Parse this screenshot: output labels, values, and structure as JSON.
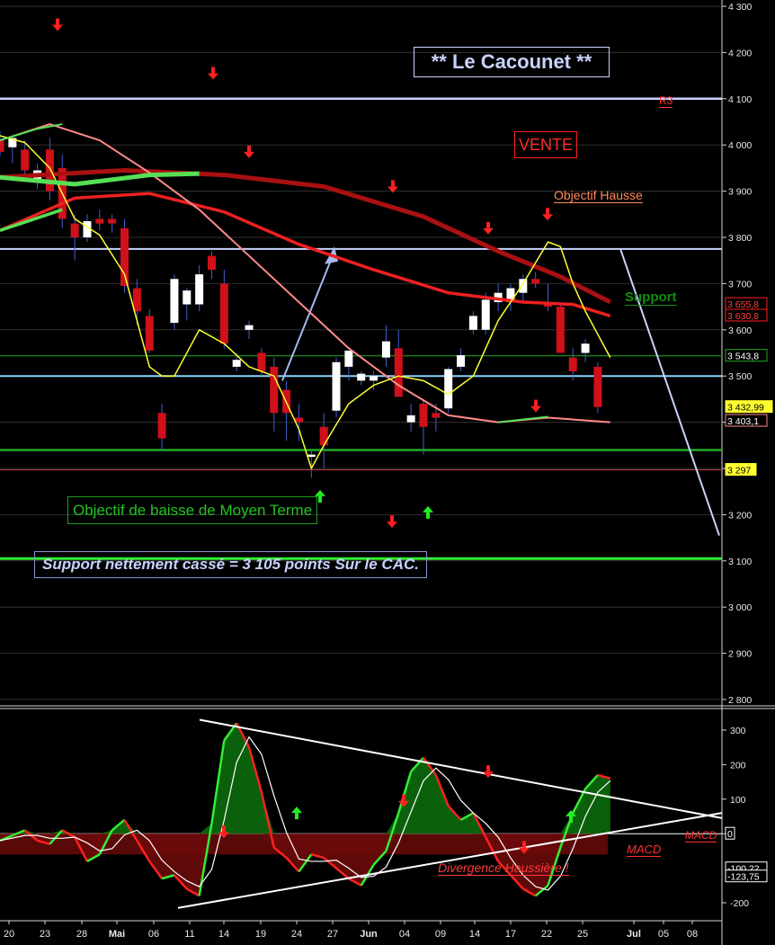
{
  "annotations": {
    "title": "** Le Cacounet **",
    "vente": "VENTE",
    "objectif_hausse": "Objectif Hausse",
    "support": "Support",
    "r3": "R3",
    "objectif_baisse": "Objectif de baisse de Moyen Terme",
    "support_casse": "Support nettement cassé = 3 105 points Sur le CAC.",
    "macd_label": "MACD",
    "macd_label_right": "MACD",
    "divergence": "Divergence Haussière !"
  },
  "colors": {
    "background": "#000000",
    "up_candle": "#ffffff",
    "down_candle": "#d0101a",
    "resistance_line": "#c8d2ff",
    "support_line": "#22dd22",
    "mm_long": "#aa1010",
    "mm_medium": "#ee2020",
    "mm_short": "#ff8a8a",
    "stoch_line": "#ffff30",
    "macd_positive": "#0c6a0c",
    "macd_negative": "#6a0a0a"
  },
  "chart_data": [
    {
      "type": "candlestick",
      "panel": "price",
      "x_tick_labels": [
        "20",
        "23",
        "28",
        "Mai",
        "06",
        "11",
        "14",
        "19",
        "24",
        "27",
        "Jun",
        "04",
        "09",
        "14",
        "17",
        "22",
        "25",
        "Jul",
        "05",
        "08"
      ],
      "y_ticks": [
        "4 300",
        "4 200",
        "4 100",
        "4 000",
        "3 900",
        "3 800",
        "3 700",
        "3 600",
        "3 500",
        "3 400",
        "3 300",
        "3 200",
        "3 100",
        "3 000",
        "2 900",
        "2 800"
      ],
      "y_tick_values": [
        4300,
        4200,
        4100,
        4000,
        3900,
        3800,
        3700,
        3600,
        3500,
        3400,
        3300,
        3200,
        3100,
        3000,
        2900,
        2800
      ],
      "ylim": [
        2780,
        4330
      ],
      "candles": [
        [
          4010,
          4030,
          3975,
          3985
        ],
        [
          3995,
          4020,
          3960,
          4015
        ],
        [
          3990,
          4010,
          3930,
          3945
        ],
        [
          3920,
          3960,
          3905,
          3945
        ],
        [
          3990,
          4015,
          3880,
          3900
        ],
        [
          3950,
          3980,
          3820,
          3840
        ],
        [
          3830,
          3850,
          3750,
          3800
        ],
        [
          3800,
          3850,
          3790,
          3835
        ],
        [
          3840,
          3860,
          3815,
          3830
        ],
        [
          3840,
          3850,
          3810,
          3830
        ],
        [
          3820,
          3840,
          3680,
          3695
        ],
        [
          3690,
          3710,
          3610,
          3640
        ],
        [
          3630,
          3645,
          3550,
          3555
        ],
        [
          3420,
          3440,
          3340,
          3365
        ],
        [
          3615,
          3720,
          3600,
          3710
        ],
        [
          3655,
          3690,
          3620,
          3685
        ],
        [
          3655,
          3740,
          3640,
          3720
        ],
        [
          3760,
          3770,
          3710,
          3730
        ],
        [
          3700,
          3730,
          3560,
          3570
        ],
        [
          3520,
          3550,
          3510,
          3535
        ],
        [
          3600,
          3620,
          3580,
          3610
        ],
        [
          3550,
          3560,
          3500,
          3510
        ],
        [
          3520,
          3540,
          3380,
          3420
        ],
        [
          3470,
          3490,
          3360,
          3420
        ],
        [
          3410,
          3440,
          3360,
          3400
        ],
        [
          3325,
          3340,
          3280,
          3330
        ],
        [
          3390,
          3420,
          3300,
          3350
        ],
        [
          3425,
          3540,
          3410,
          3530
        ],
        [
          3520,
          3550,
          3490,
          3555
        ],
        [
          3490,
          3510,
          3480,
          3505
        ],
        [
          3490,
          3510,
          3470,
          3500
        ],
        [
          3540,
          3610,
          3520,
          3575
        ],
        [
          3560,
          3600,
          3460,
          3455
        ],
        [
          3400,
          3440,
          3380,
          3415
        ],
        [
          3440,
          3450,
          3330,
          3390
        ],
        [
          3420,
          3440,
          3380,
          3410
        ],
        [
          3430,
          3520,
          3420,
          3515
        ],
        [
          3520,
          3560,
          3510,
          3545
        ],
        [
          3600,
          3640,
          3590,
          3630
        ],
        [
          3600,
          3680,
          3590,
          3665
        ],
        [
          3660,
          3700,
          3640,
          3680
        ],
        [
          3660,
          3700,
          3640,
          3690
        ],
        [
          3680,
          3720,
          3660,
          3710
        ],
        [
          3710,
          3725,
          3690,
          3700
        ],
        [
          3660,
          3700,
          3640,
          3650
        ],
        [
          3650,
          3660,
          3550,
          3550
        ],
        [
          3540,
          3560,
          3490,
          3510
        ],
        [
          3550,
          3580,
          3530,
          3570
        ],
        [
          3520,
          3530,
          3420,
          3432.99
        ]
      ],
      "indicators": {
        "ma_long": {
          "x": [
            0,
            10,
            18,
            26,
            34,
            40,
            45,
            49
          ],
          "values": [
            3930,
            3945,
            3935,
            3910,
            3845,
            3770,
            3715,
            3660
          ]
        },
        "ma_medium": {
          "x": [
            0,
            6,
            12,
            18,
            24,
            30,
            36,
            42,
            46,
            49
          ],
          "values": [
            3815,
            3885,
            3895,
            3855,
            3785,
            3730,
            3680,
            3660,
            3655,
            3630
          ]
        },
        "ma_short": {
          "x": [
            0,
            4,
            8,
            12,
            16,
            20,
            24,
            28,
            32,
            36,
            40,
            44,
            49
          ],
          "values": [
            4010,
            4045,
            4010,
            3940,
            3860,
            3760,
            3660,
            3560,
            3480,
            3415,
            3400,
            3410,
            3400
          ]
        },
        "stochastic": {
          "x": [
            0,
            2,
            4,
            6,
            8,
            10,
            12,
            13,
            14,
            16,
            18,
            20,
            22,
            24,
            25,
            26,
            28,
            30,
            32,
            34,
            36,
            38,
            40,
            42,
            44,
            45,
            46,
            47,
            48,
            49
          ],
          "values": [
            4020,
            4005,
            3950,
            3840,
            3805,
            3720,
            3520,
            3500,
            3500,
            3600,
            3570,
            3520,
            3500,
            3385,
            3300,
            3350,
            3440,
            3480,
            3500,
            3490,
            3460,
            3500,
            3620,
            3700,
            3790,
            3780,
            3700,
            3640,
            3590,
            3540
          ]
        }
      },
      "levels": [
        {
          "name": "R3",
          "value": 4100
        },
        {
          "name": "Objectif Hausse",
          "value": 3775
        },
        {
          "name": "Support",
          "value": 3543.8
        },
        {
          "name": "pivot",
          "value": 3500
        },
        {
          "name": "support_low",
          "value": 3340
        },
        {
          "name": "low_mark",
          "value": 3297
        },
        {
          "name": "Objectif de baisse de Moyen Terme",
          "value": 3105
        }
      ],
      "price_tags": [
        {
          "value": 3655.8,
          "text": "3 655,8"
        },
        {
          "value": 3630.8,
          "text": "3 630,8"
        },
        {
          "value": 3543.8,
          "text": "3 543,8"
        },
        {
          "value": 3432.99,
          "text": "3 432,99"
        },
        {
          "value": 3403.1,
          "text": "3 403,1"
        },
        {
          "value": 3297,
          "text": "3 297"
        }
      ],
      "signals": [
        {
          "type": "down",
          "x": 4,
          "value": 4260
        },
        {
          "type": "down",
          "x": 18,
          "value": 4155
        },
        {
          "type": "down",
          "x": 21,
          "value": 3985
        },
        {
          "type": "down",
          "x": 33,
          "value": 3910
        },
        {
          "type": "down",
          "x": 41,
          "value": 3820
        },
        {
          "type": "down",
          "x": 46,
          "value": 3850
        },
        {
          "type": "down",
          "x": 45,
          "value": 3435
        },
        {
          "type": "down",
          "x": 33,
          "value": 3185
        },
        {
          "type": "up",
          "x": 26,
          "value": 3240
        },
        {
          "type": "up",
          "x": 35,
          "value": 3205
        }
      ]
    },
    {
      "type": "area",
      "panel": "macd",
      "y_ticks": [
        "300",
        "200",
        "100",
        "0",
        "-200"
      ],
      "y_tick_values": [
        300,
        200,
        100,
        0,
        -200
      ],
      "ylim": [
        -250,
        340
      ],
      "x": [
        0,
        1,
        2,
        3,
        4,
        5,
        6,
        7,
        8,
        9,
        10,
        11,
        12,
        13,
        14,
        15,
        16,
        17,
        18,
        19,
        20,
        21,
        22,
        23,
        24,
        25,
        26,
        27,
        28,
        29,
        30,
        31,
        32,
        33,
        34,
        35,
        36,
        37,
        38,
        39,
        40,
        41,
        42,
        43,
        44,
        45,
        46,
        47,
        48,
        49
      ],
      "macd": [
        -20,
        -5,
        10,
        -20,
        -30,
        10,
        -10,
        -80,
        -60,
        10,
        40,
        -20,
        -80,
        -130,
        -120,
        -160,
        -180,
        30,
        270,
        320,
        250,
        120,
        -40,
        -70,
        -110,
        -60,
        -70,
        -100,
        -130,
        -150,
        -90,
        -50,
        60,
        180,
        220,
        170,
        80,
        40,
        60,
        -10,
        -80,
        -120,
        -160,
        -180,
        -150,
        -40,
        60,
        130,
        170,
        160
      ]
    }
  ],
  "macd_signal_points": [
    {
      "type": "down",
      "x": 23,
      "value": 5
    },
    {
      "type": "up",
      "x": 29,
      "value": 60
    },
    {
      "type": "down",
      "x": 33,
      "value": 95
    },
    {
      "type": "down",
      "x": 40,
      "value": 180
    },
    {
      "type": "up",
      "x": 47,
      "value": 50
    },
    {
      "type": "down",
      "x": 44,
      "value": -40
    }
  ],
  "macd_tags": [
    {
      "value": 0,
      "text": "0"
    },
    {
      "value": -100.22,
      "text": "-100,22"
    },
    {
      "value": -123.75,
      "text": "-123,75"
    }
  ]
}
